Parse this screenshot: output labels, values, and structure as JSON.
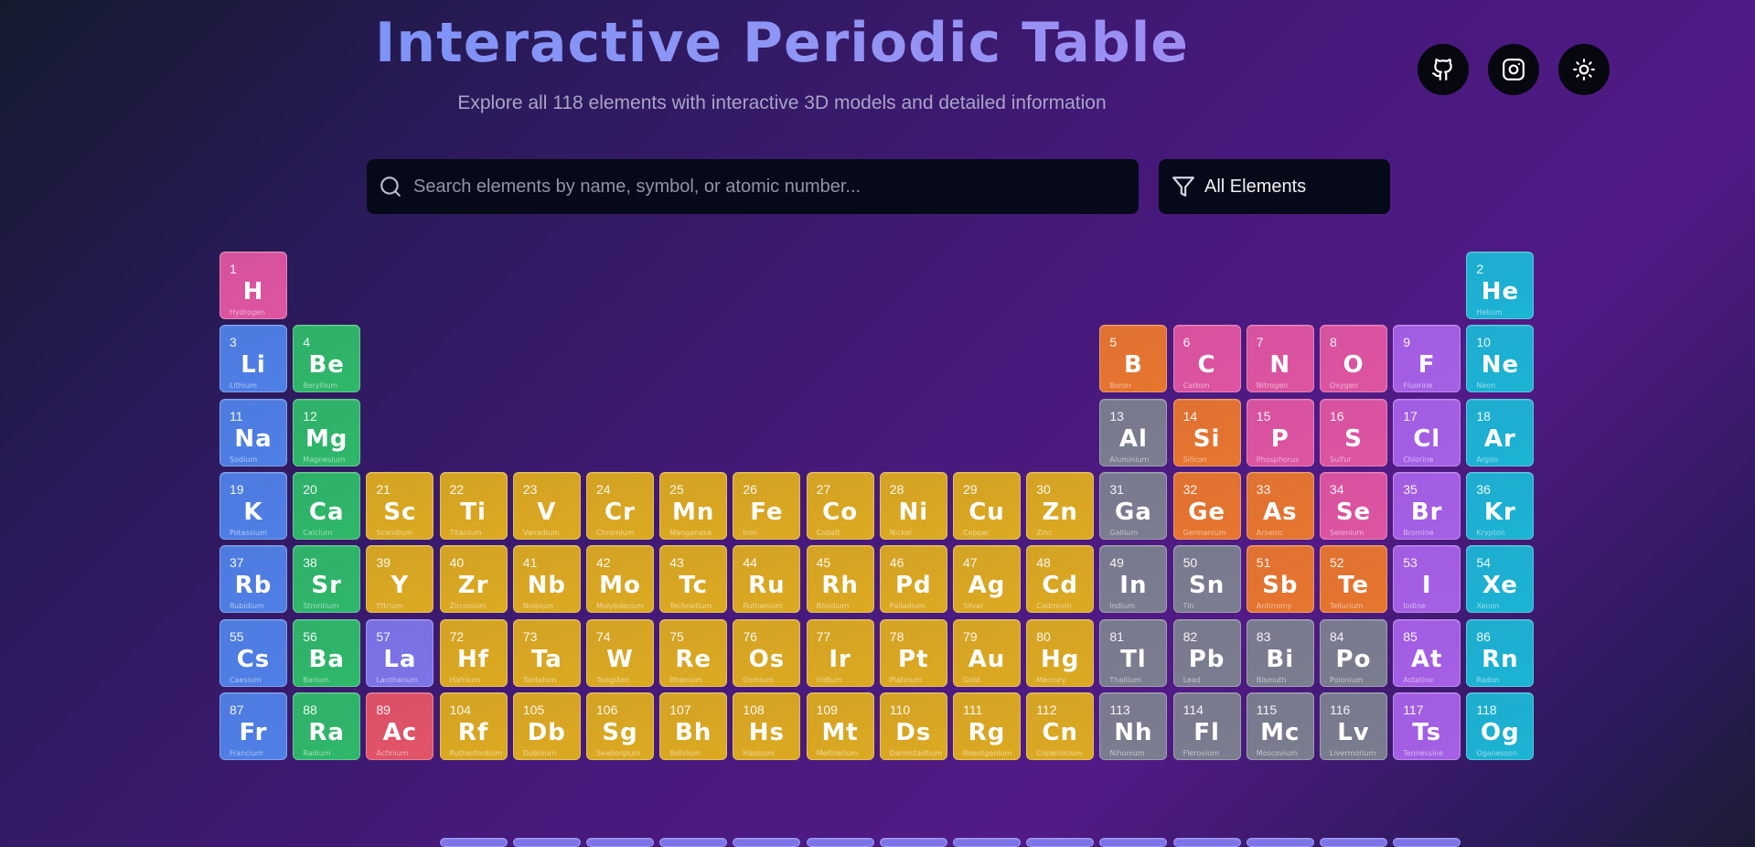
{
  "header": {
    "title": "Interactive Periodic Table",
    "subtitle": "Explore all 118 elements with interactive 3D models and detailed information"
  },
  "toolbar": {
    "icons": [
      "github-icon",
      "instagram-icon",
      "sun-icon"
    ]
  },
  "search": {
    "placeholder": "Search elements by name, symbol, or atomic number...",
    "value": ""
  },
  "filter": {
    "selected": "All Elements"
  },
  "colors": {
    "alkali-metal": "#4f80e6",
    "alkaline-earth": "#2fb86a",
    "transition-metal": "#dcaa20",
    "post-transition": "#7b7e8f",
    "metalloid": "#e7762e",
    "nonmetal": "#de55a0",
    "halogen": "#a660e6",
    "noble-gas": "#1cb4d4",
    "lanthanide": "#7d74e8",
    "actinide": "#e25468"
  },
  "elements": [
    {
      "n": "1",
      "s": "H",
      "name": "Hydrogen",
      "c": "nonmetal",
      "col": 1,
      "row": 1
    },
    {
      "n": "2",
      "s": "He",
      "name": "Helium",
      "c": "noble-gas",
      "col": 18,
      "row": 1
    },
    {
      "n": "3",
      "s": "Li",
      "name": "Lithium",
      "c": "alkali-metal",
      "col": 1,
      "row": 2
    },
    {
      "n": "4",
      "s": "Be",
      "name": "Beryllium",
      "c": "alkaline-earth",
      "col": 2,
      "row": 2
    },
    {
      "n": "5",
      "s": "B",
      "name": "Boron",
      "c": "metalloid",
      "col": 13,
      "row": 2
    },
    {
      "n": "6",
      "s": "C",
      "name": "Carbon",
      "c": "nonmetal",
      "col": 14,
      "row": 2
    },
    {
      "n": "7",
      "s": "N",
      "name": "Nitrogen",
      "c": "nonmetal",
      "col": 15,
      "row": 2
    },
    {
      "n": "8",
      "s": "O",
      "name": "Oxygen",
      "c": "nonmetal",
      "col": 16,
      "row": 2
    },
    {
      "n": "9",
      "s": "F",
      "name": "Fluorine",
      "c": "halogen",
      "col": 17,
      "row": 2
    },
    {
      "n": "10",
      "s": "Ne",
      "name": "Neon",
      "c": "noble-gas",
      "col": 18,
      "row": 2
    },
    {
      "n": "11",
      "s": "Na",
      "name": "Sodium",
      "c": "alkali-metal",
      "col": 1,
      "row": 3
    },
    {
      "n": "12",
      "s": "Mg",
      "name": "Magnesium",
      "c": "alkaline-earth",
      "col": 2,
      "row": 3
    },
    {
      "n": "13",
      "s": "Al",
      "name": "Aluminium",
      "c": "post-transition",
      "col": 13,
      "row": 3
    },
    {
      "n": "14",
      "s": "Si",
      "name": "Silicon",
      "c": "metalloid",
      "col": 14,
      "row": 3
    },
    {
      "n": "15",
      "s": "P",
      "name": "Phosphorus",
      "c": "nonmetal",
      "col": 15,
      "row": 3
    },
    {
      "n": "16",
      "s": "S",
      "name": "Sulfur",
      "c": "nonmetal",
      "col": 16,
      "row": 3
    },
    {
      "n": "17",
      "s": "Cl",
      "name": "Chlorine",
      "c": "halogen",
      "col": 17,
      "row": 3
    },
    {
      "n": "18",
      "s": "Ar",
      "name": "Argon",
      "c": "noble-gas",
      "col": 18,
      "row": 3
    },
    {
      "n": "19",
      "s": "K",
      "name": "Potassium",
      "c": "alkali-metal",
      "col": 1,
      "row": 4
    },
    {
      "n": "20",
      "s": "Ca",
      "name": "Calcium",
      "c": "alkaline-earth",
      "col": 2,
      "row": 4
    },
    {
      "n": "21",
      "s": "Sc",
      "name": "Scandium",
      "c": "transition-metal",
      "col": 3,
      "row": 4
    },
    {
      "n": "22",
      "s": "Ti",
      "name": "Titanium",
      "c": "transition-metal",
      "col": 4,
      "row": 4
    },
    {
      "n": "23",
      "s": "V",
      "name": "Vanadium",
      "c": "transition-metal",
      "col": 5,
      "row": 4
    },
    {
      "n": "24",
      "s": "Cr",
      "name": "Chromium",
      "c": "transition-metal",
      "col": 6,
      "row": 4
    },
    {
      "n": "25",
      "s": "Mn",
      "name": "Manganese",
      "c": "transition-metal",
      "col": 7,
      "row": 4
    },
    {
      "n": "26",
      "s": "Fe",
      "name": "Iron",
      "c": "transition-metal",
      "col": 8,
      "row": 4
    },
    {
      "n": "27",
      "s": "Co",
      "name": "Cobalt",
      "c": "transition-metal",
      "col": 9,
      "row": 4
    },
    {
      "n": "28",
      "s": "Ni",
      "name": "Nickel",
      "c": "transition-metal",
      "col": 10,
      "row": 4
    },
    {
      "n": "29",
      "s": "Cu",
      "name": "Copper",
      "c": "transition-metal",
      "col": 11,
      "row": 4
    },
    {
      "n": "30",
      "s": "Zn",
      "name": "Zinc",
      "c": "transition-metal",
      "col": 12,
      "row": 4
    },
    {
      "n": "31",
      "s": "Ga",
      "name": "Gallium",
      "c": "post-transition",
      "col": 13,
      "row": 4
    },
    {
      "n": "32",
      "s": "Ge",
      "name": "Germanium",
      "c": "metalloid",
      "col": 14,
      "row": 4
    },
    {
      "n": "33",
      "s": "As",
      "name": "Arsenic",
      "c": "metalloid",
      "col": 15,
      "row": 4
    },
    {
      "n": "34",
      "s": "Se",
      "name": "Selenium",
      "c": "nonmetal",
      "col": 16,
      "row": 4
    },
    {
      "n": "35",
      "s": "Br",
      "name": "Bromine",
      "c": "halogen",
      "col": 17,
      "row": 4
    },
    {
      "n": "36",
      "s": "Kr",
      "name": "Krypton",
      "c": "noble-gas",
      "col": 18,
      "row": 4
    },
    {
      "n": "37",
      "s": "Rb",
      "name": "Rubidium",
      "c": "alkali-metal",
      "col": 1,
      "row": 5
    },
    {
      "n": "38",
      "s": "Sr",
      "name": "Strontium",
      "c": "alkaline-earth",
      "col": 2,
      "row": 5
    },
    {
      "n": "39",
      "s": "Y",
      "name": "Yttrium",
      "c": "transition-metal",
      "col": 3,
      "row": 5
    },
    {
      "n": "40",
      "s": "Zr",
      "name": "Zirconium",
      "c": "transition-metal",
      "col": 4,
      "row": 5
    },
    {
      "n": "41",
      "s": "Nb",
      "name": "Niobium",
      "c": "transition-metal",
      "col": 5,
      "row": 5
    },
    {
      "n": "42",
      "s": "Mo",
      "name": "Molybdenum",
      "c": "transition-metal",
      "col": 6,
      "row": 5
    },
    {
      "n": "43",
      "s": "Tc",
      "name": "Technetium",
      "c": "transition-metal",
      "col": 7,
      "row": 5
    },
    {
      "n": "44",
      "s": "Ru",
      "name": "Ruthenium",
      "c": "transition-metal",
      "col": 8,
      "row": 5
    },
    {
      "n": "45",
      "s": "Rh",
      "name": "Rhodium",
      "c": "transition-metal",
      "col": 9,
      "row": 5
    },
    {
      "n": "46",
      "s": "Pd",
      "name": "Palladium",
      "c": "transition-metal",
      "col": 10,
      "row": 5
    },
    {
      "n": "47",
      "s": "Ag",
      "name": "Silver",
      "c": "transition-metal",
      "col": 11,
      "row": 5
    },
    {
      "n": "48",
      "s": "Cd",
      "name": "Cadmium",
      "c": "transition-metal",
      "col": 12,
      "row": 5
    },
    {
      "n": "49",
      "s": "In",
      "name": "Indium",
      "c": "post-transition",
      "col": 13,
      "row": 5
    },
    {
      "n": "50",
      "s": "Sn",
      "name": "Tin",
      "c": "post-transition",
      "col": 14,
      "row": 5
    },
    {
      "n": "51",
      "s": "Sb",
      "name": "Antimony",
      "c": "metalloid",
      "col": 15,
      "row": 5
    },
    {
      "n": "52",
      "s": "Te",
      "name": "Tellurium",
      "c": "metalloid",
      "col": 16,
      "row": 5
    },
    {
      "n": "53",
      "s": "I",
      "name": "Iodine",
      "c": "halogen",
      "col": 17,
      "row": 5
    },
    {
      "n": "54",
      "s": "Xe",
      "name": "Xenon",
      "c": "noble-gas",
      "col": 18,
      "row": 5
    },
    {
      "n": "55",
      "s": "Cs",
      "name": "Caesium",
      "c": "alkali-metal",
      "col": 1,
      "row": 6
    },
    {
      "n": "56",
      "s": "Ba",
      "name": "Barium",
      "c": "alkaline-earth",
      "col": 2,
      "row": 6
    },
    {
      "n": "57",
      "s": "La",
      "name": "Lanthanum",
      "c": "lanthanide",
      "col": 3,
      "row": 6
    },
    {
      "n": "72",
      "s": "Hf",
      "name": "Hafnium",
      "c": "transition-metal",
      "col": 4,
      "row": 6
    },
    {
      "n": "73",
      "s": "Ta",
      "name": "Tantalum",
      "c": "transition-metal",
      "col": 5,
      "row": 6
    },
    {
      "n": "74",
      "s": "W",
      "name": "Tungsten",
      "c": "transition-metal",
      "col": 6,
      "row": 6
    },
    {
      "n": "75",
      "s": "Re",
      "name": "Rhenium",
      "c": "transition-metal",
      "col": 7,
      "row": 6
    },
    {
      "n": "76",
      "s": "Os",
      "name": "Osmium",
      "c": "transition-metal",
      "col": 8,
      "row": 6
    },
    {
      "n": "77",
      "s": "Ir",
      "name": "Iridium",
      "c": "transition-metal",
      "col": 9,
      "row": 6
    },
    {
      "n": "78",
      "s": "Pt",
      "name": "Platinum",
      "c": "transition-metal",
      "col": 10,
      "row": 6
    },
    {
      "n": "79",
      "s": "Au",
      "name": "Gold",
      "c": "transition-metal",
      "col": 11,
      "row": 6
    },
    {
      "n": "80",
      "s": "Hg",
      "name": "Mercury",
      "c": "transition-metal",
      "col": 12,
      "row": 6
    },
    {
      "n": "81",
      "s": "Tl",
      "name": "Thallium",
      "c": "post-transition",
      "col": 13,
      "row": 6
    },
    {
      "n": "82",
      "s": "Pb",
      "name": "Lead",
      "c": "post-transition",
      "col": 14,
      "row": 6
    },
    {
      "n": "83",
      "s": "Bi",
      "name": "Bismuth",
      "c": "post-transition",
      "col": 15,
      "row": 6
    },
    {
      "n": "84",
      "s": "Po",
      "name": "Polonium",
      "c": "post-transition",
      "col": 16,
      "row": 6
    },
    {
      "n": "85",
      "s": "At",
      "name": "Astatine",
      "c": "halogen",
      "col": 17,
      "row": 6
    },
    {
      "n": "86",
      "s": "Rn",
      "name": "Radon",
      "c": "noble-gas",
      "col": 18,
      "row": 6
    },
    {
      "n": "87",
      "s": "Fr",
      "name": "Francium",
      "c": "alkali-metal",
      "col": 1,
      "row": 7
    },
    {
      "n": "88",
      "s": "Ra",
      "name": "Radium",
      "c": "alkaline-earth",
      "col": 2,
      "row": 7
    },
    {
      "n": "89",
      "s": "Ac",
      "name": "Actinium",
      "c": "actinide",
      "col": 3,
      "row": 7
    },
    {
      "n": "104",
      "s": "Rf",
      "name": "Rutherfordium",
      "c": "transition-metal",
      "col": 4,
      "row": 7
    },
    {
      "n": "105",
      "s": "Db",
      "name": "Dubnium",
      "c": "transition-metal",
      "col": 5,
      "row": 7
    },
    {
      "n": "106",
      "s": "Sg",
      "name": "Seaborgium",
      "c": "transition-metal",
      "col": 6,
      "row": 7
    },
    {
      "n": "107",
      "s": "Bh",
      "name": "Bohrium",
      "c": "transition-metal",
      "col": 7,
      "row": 7
    },
    {
      "n": "108",
      "s": "Hs",
      "name": "Hassium",
      "c": "transition-metal",
      "col": 8,
      "row": 7
    },
    {
      "n": "109",
      "s": "Mt",
      "name": "Meitnerium",
      "c": "transition-metal",
      "col": 9,
      "row": 7
    },
    {
      "n": "110",
      "s": "Ds",
      "name": "Darmstadtium",
      "c": "transition-metal",
      "col": 10,
      "row": 7
    },
    {
      "n": "111",
      "s": "Rg",
      "name": "Roentgenium",
      "c": "transition-metal",
      "col": 11,
      "row": 7
    },
    {
      "n": "112",
      "s": "Cn",
      "name": "Copernicium",
      "c": "transition-metal",
      "col": 12,
      "row": 7
    },
    {
      "n": "113",
      "s": "Nh",
      "name": "Nihonium",
      "c": "post-transition",
      "col": 13,
      "row": 7
    },
    {
      "n": "114",
      "s": "Fl",
      "name": "Flerovium",
      "c": "post-transition",
      "col": 14,
      "row": 7
    },
    {
      "n": "115",
      "s": "Mc",
      "name": "Moscovium",
      "c": "post-transition",
      "col": 15,
      "row": 7
    },
    {
      "n": "116",
      "s": "Lv",
      "name": "Livermorium",
      "c": "post-transition",
      "col": 16,
      "row": 7
    },
    {
      "n": "117",
      "s": "Ts",
      "name": "Tennessine",
      "c": "halogen",
      "col": 17,
      "row": 7
    },
    {
      "n": "118",
      "s": "Og",
      "name": "Oganesson",
      "c": "noble-gas",
      "col": 18,
      "row": 7
    }
  ]
}
